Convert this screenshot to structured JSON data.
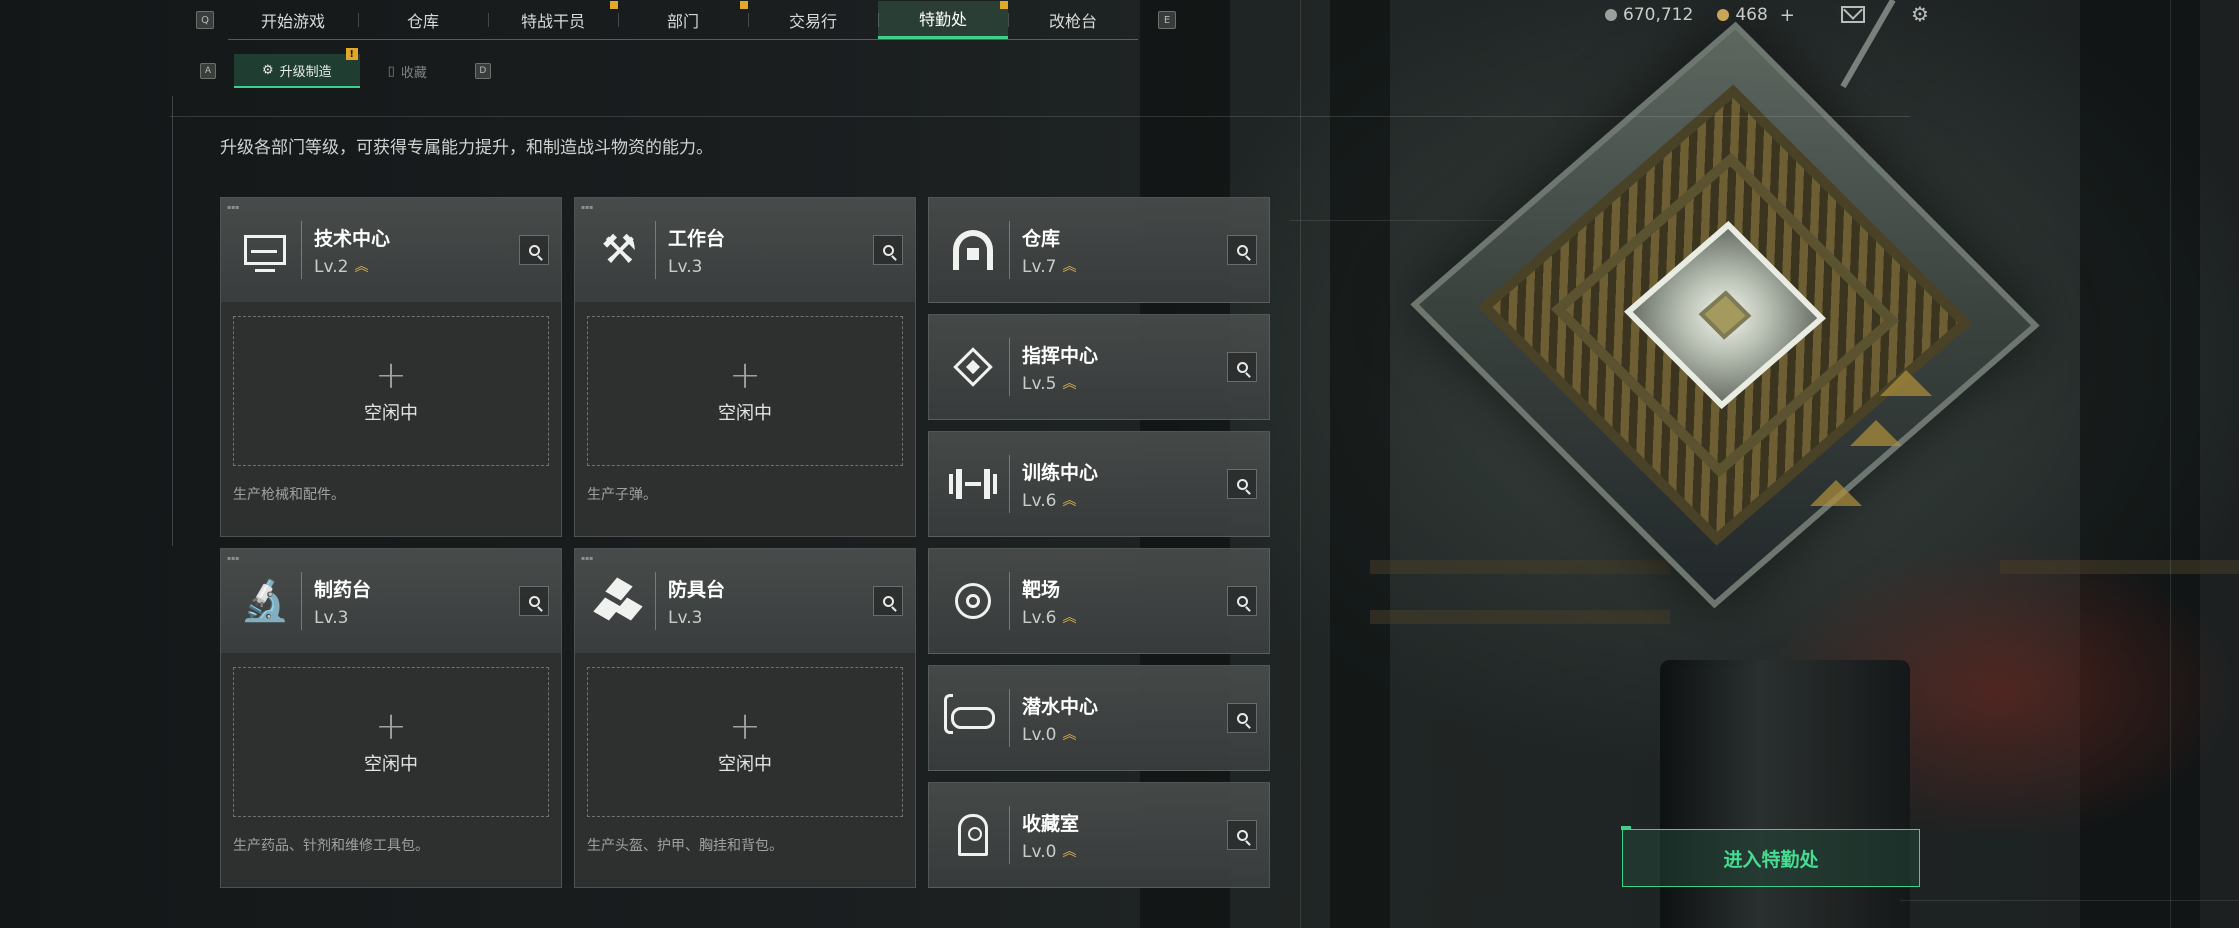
{
  "topnav": {
    "left_key": "Q",
    "right_key": "E",
    "tabs": [
      {
        "label": "开始游戏",
        "badge": false
      },
      {
        "label": "仓库",
        "badge": false
      },
      {
        "label": "特战干员",
        "badge": true
      },
      {
        "label": "部门",
        "badge": true
      },
      {
        "label": "交易行",
        "badge": false
      },
      {
        "label": "特勤处",
        "badge": true,
        "active": true
      },
      {
        "label": "改枪台",
        "badge": false
      }
    ]
  },
  "currency": {
    "coins": "670,712",
    "premium": "468",
    "add_label": "+"
  },
  "subnav": {
    "left_key": "A",
    "right_key": "D",
    "tabs": [
      {
        "label": "升级制造",
        "active": true,
        "warning": "!"
      },
      {
        "label": "收藏",
        "active": false
      }
    ]
  },
  "description": "升级各部门等级，可获得专属能力提升，和制造战斗物资的能力。",
  "production_cards": [
    {
      "name": "技术中心",
      "level": "Lv.2",
      "upgradable": true,
      "icon": "monitor-icon",
      "slot_label": "空闲中",
      "production": "生产枪械和配件。"
    },
    {
      "name": "工作台",
      "level": "Lv.3",
      "upgradable": false,
      "icon": "tools-icon",
      "slot_label": "空闲中",
      "production": "生产子弹。"
    },
    {
      "name": "制药台",
      "level": "Lv.3",
      "upgradable": false,
      "icon": "microscope-icon",
      "slot_label": "空闲中",
      "production": "生产药品、针剂和维修工具包。"
    },
    {
      "name": "防具台",
      "level": "Lv.3",
      "upgradable": false,
      "icon": "armor-boxes-icon",
      "slot_label": "空闲中",
      "production": "生产头盔、护甲、胸挂和背包。"
    }
  ],
  "facility_cards": [
    {
      "name": "仓库",
      "level": "Lv.7",
      "upgradable": true,
      "icon": "warehouse-icon"
    },
    {
      "name": "指挥中心",
      "level": "Lv.5",
      "upgradable": true,
      "icon": "command-center-icon"
    },
    {
      "name": "训练中心",
      "level": "Lv.6",
      "upgradable": true,
      "icon": "dumbbell-icon"
    },
    {
      "name": "靶场",
      "level": "Lv.6",
      "upgradable": true,
      "icon": "target-icon"
    },
    {
      "name": "潜水中心",
      "level": "Lv.0",
      "upgradable": true,
      "icon": "diving-goggles-icon"
    },
    {
      "name": "收藏室",
      "level": "Lv.0",
      "upgradable": true,
      "icon": "collection-capsule-icon"
    }
  ],
  "enter_button": "进入特勤处",
  "colors": {
    "accent": "#3fd08a",
    "badge": "#e2a82a",
    "upgrade_arrow": "#e0b54a",
    "card_bg": "#3a3d3d"
  }
}
